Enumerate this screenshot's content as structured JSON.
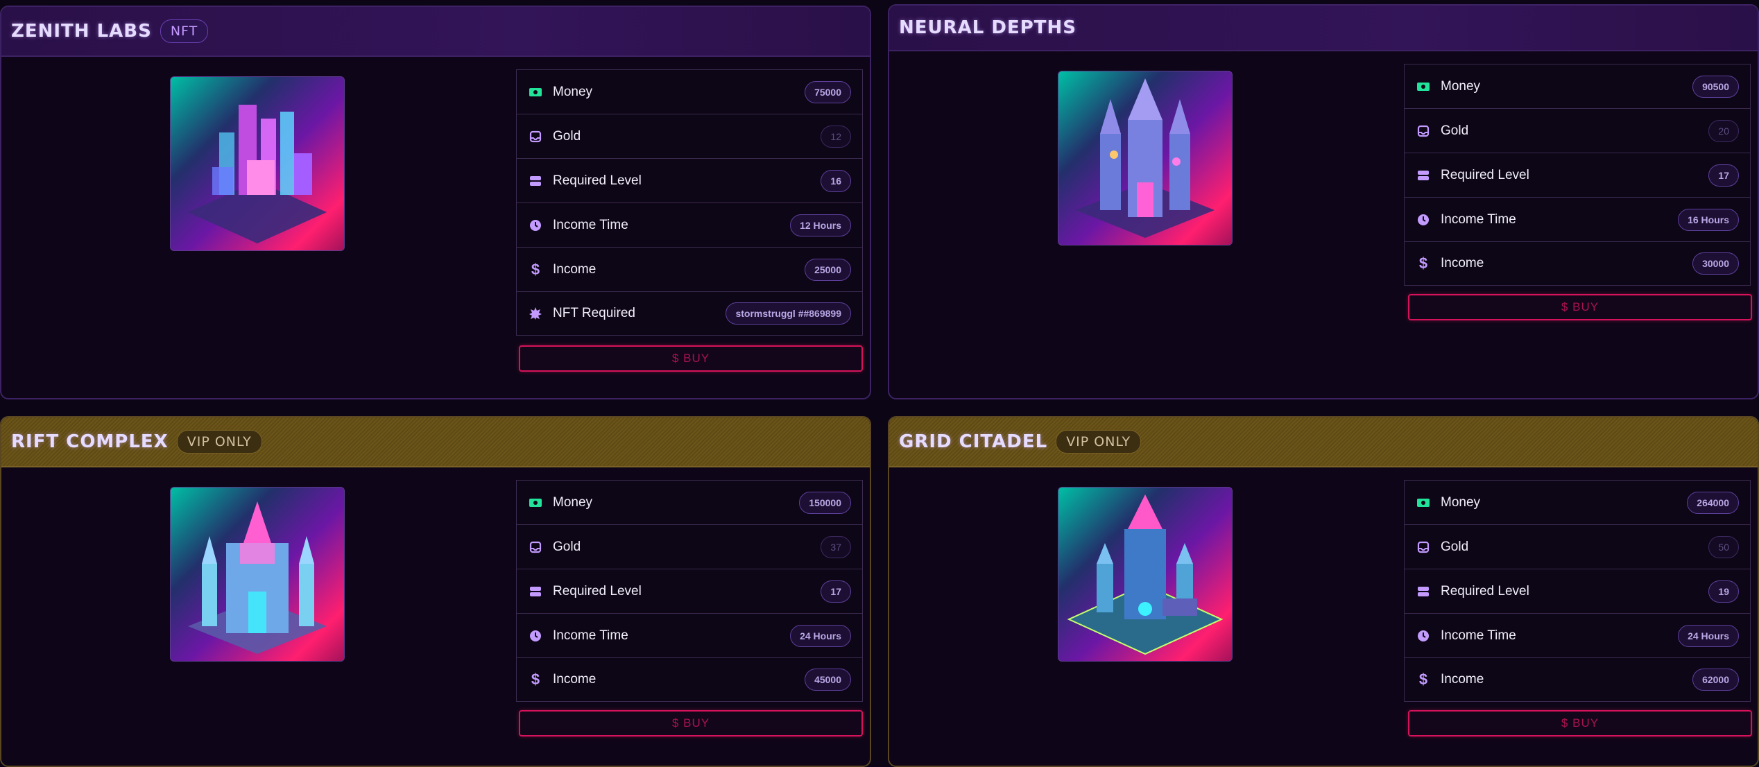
{
  "cards": [
    {
      "title": "ZENITH LABS",
      "badge": "NFT",
      "stats": [
        {
          "label": "Money",
          "value": "75000",
          "icon": "money-icon"
        },
        {
          "label": "Gold",
          "value": "12",
          "icon": "gold-icon"
        },
        {
          "label": "Required Level",
          "value": "16",
          "icon": "level-icon"
        },
        {
          "label": "Income Time",
          "value": "12 Hours",
          "icon": "clock-icon"
        },
        {
          "label": "Income",
          "value": "25000",
          "icon": "dollar-icon"
        },
        {
          "label": "NFT Required",
          "value": "stormstruggl ##869899",
          "icon": "nft-icon"
        }
      ],
      "buy_label": "$ BUY"
    },
    {
      "title": "NEURAL DEPTHS",
      "stats": [
        {
          "label": "Money",
          "value": "90500",
          "icon": "money-icon"
        },
        {
          "label": "Gold",
          "value": "20",
          "icon": "gold-icon"
        },
        {
          "label": "Required Level",
          "value": "17",
          "icon": "level-icon"
        },
        {
          "label": "Income Time",
          "value": "16 Hours",
          "icon": "clock-icon"
        },
        {
          "label": "Income",
          "value": "30000",
          "icon": "dollar-icon"
        }
      ],
      "buy_label": "$ BUY"
    },
    {
      "title": "RIFT COMPLEX",
      "badge": "VIP ONLY",
      "stats": [
        {
          "label": "Money",
          "value": "150000",
          "icon": "money-icon"
        },
        {
          "label": "Gold",
          "value": "37",
          "icon": "gold-icon"
        },
        {
          "label": "Required Level",
          "value": "17",
          "icon": "level-icon"
        },
        {
          "label": "Income Time",
          "value": "24 Hours",
          "icon": "clock-icon"
        },
        {
          "label": "Income",
          "value": "45000",
          "icon": "dollar-icon"
        }
      ],
      "buy_label": "$ BUY"
    },
    {
      "title": "GRID CITADEL",
      "badge": "VIP ONLY",
      "stats": [
        {
          "label": "Money",
          "value": "264000",
          "icon": "money-icon"
        },
        {
          "label": "Gold",
          "value": "50",
          "icon": "gold-icon"
        },
        {
          "label": "Required Level",
          "value": "19",
          "icon": "level-icon"
        },
        {
          "label": "Income Time",
          "value": "24 Hours",
          "icon": "clock-icon"
        },
        {
          "label": "Income",
          "value": "62000",
          "icon": "dollar-icon"
        }
      ],
      "buy_label": "$ BUY"
    }
  ],
  "colors": {
    "money_icon": "#22e39a",
    "stat_icon": "#c39bff",
    "buy_border": "#d6135a",
    "vip_header": "#6c5519",
    "nft_header": "#2a1048"
  }
}
